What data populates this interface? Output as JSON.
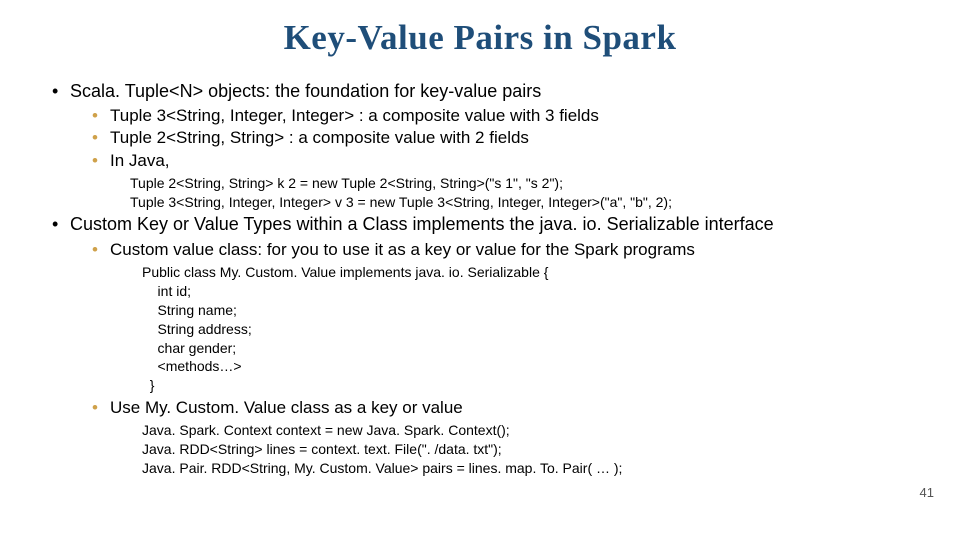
{
  "title": "Key-Value Pairs in Spark",
  "page_number": "41",
  "b1": {
    "text": "Scala. Tuple<N> objects: the foundation for key-value pairs",
    "sub": {
      "a": "Tuple 3<String, Integer, Integer> : a composite value with 3 fields",
      "b": "Tuple 2<String, String> : a composite value with 2 fields",
      "c": "In Java,"
    },
    "code": "Tuple 2<String, String> k 2 = new Tuple 2<String, String>(\"s 1\", \"s 2\");\nTuple 3<String, Integer, Integer> v 3 = new Tuple 3<String, Integer, Integer>(\"a\", \"b\", 2);"
  },
  "b2": {
    "text": "Custom Key or Value Types within a Class implements the java. io. Serializable interface",
    "sub1": "Custom value class: for you to use it as a key or value for the Spark programs",
    "code1": "Public class My. Custom. Value implements java. io. Serializable {\n    int id;\n    String name;\n    String address;\n    char gender;\n    <methods…>\n  }",
    "sub2": "Use My. Custom. Value class as a key or value",
    "code2": "Java. Spark. Context context = new Java. Spark. Context();\nJava. RDD<String> lines = context. text. File(\". /data. txt\");\nJava. Pair. RDD<String, My. Custom. Value> pairs = lines. map. To. Pair( … );"
  }
}
